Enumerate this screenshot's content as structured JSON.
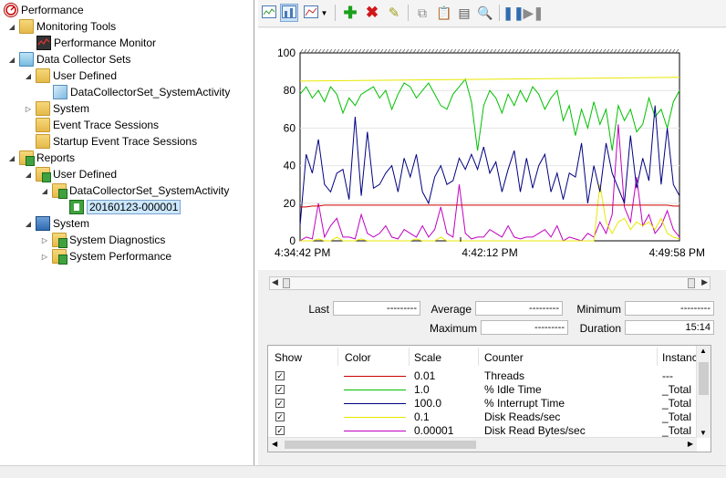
{
  "tree": {
    "root": "Performance",
    "monitoring_tools": "Monitoring Tools",
    "performance_monitor": "Performance Monitor",
    "data_collector_sets": "Data Collector Sets",
    "user_defined": "User Defined",
    "dcs_system_activity": "DataCollectorSet_SystemActivity",
    "system": "System",
    "event_trace_sessions": "Event Trace Sessions",
    "startup_event_trace_sessions": "Startup Event Trace Sessions",
    "reports": "Reports",
    "reports_user_defined": "User Defined",
    "reports_dcs_system_activity": "DataCollectorSet_SystemActivity",
    "report_item": "20160123-000001",
    "reports_system": "System",
    "system_diagnostics": "System Diagnostics",
    "system_performance": "System Performance"
  },
  "toolbar": {
    "buttons": [
      "view-graph-icon",
      "view-histogram-icon",
      "change-graph-type-icon",
      "add-counter-icon",
      "delete-counter-icon",
      "highlight-icon",
      "copy-properties-icon",
      "paste-counter-list-icon",
      "properties-icon",
      "zoom-icon",
      "freeze-display-icon",
      "update-data-icon"
    ]
  },
  "graph": {
    "x_labels": [
      "4:34:42 PM",
      "4:42:12 PM",
      "4:49:58 PM"
    ],
    "y_labels": [
      "100",
      "80",
      "60",
      "40",
      "20",
      "0"
    ]
  },
  "stats": {
    "last_label": "Last",
    "last_value": "---------",
    "average_label": "Average",
    "average_value": "---------",
    "minimum_label": "Minimum",
    "minimum_value": "---------",
    "maximum_label": "Maximum",
    "maximum_value": "---------",
    "duration_label": "Duration",
    "duration_value": "15:14"
  },
  "legend": {
    "headers": {
      "show": "Show",
      "color": "Color",
      "scale": "Scale",
      "counter": "Counter",
      "instance": "Instanc"
    },
    "rows": [
      {
        "scale": "0.01",
        "counter": "Threads",
        "instance": "---",
        "color": "#d00000"
      },
      {
        "scale": "1.0",
        "counter": "% Idle Time",
        "instance": "_Total",
        "color": "#00c000"
      },
      {
        "scale": "100.0",
        "counter": "% Interrupt Time",
        "instance": "_Total",
        "color": "#000080"
      },
      {
        "scale": "0.1",
        "counter": "Disk Reads/sec",
        "instance": "_Total",
        "color": "#e8e800"
      },
      {
        "scale": "0.00001",
        "counter": "Disk Read Bytes/sec",
        "instance": "_Total",
        "color": "#c000c0"
      }
    ]
  },
  "chart_data": {
    "type": "line",
    "ylim": [
      0,
      100
    ],
    "x_ticks": [
      "4:34:42 PM",
      "4:42:12 PM",
      "4:49:58 PM"
    ],
    "grid": true,
    "series": [
      {
        "name": "Threads",
        "color": "#d00000",
        "values": [
          18,
          18,
          18.5,
          18.5,
          19,
          19,
          19,
          19,
          19,
          19,
          19,
          19,
          19,
          19,
          19,
          19,
          19,
          19,
          19,
          19,
          19,
          19,
          19,
          19,
          19,
          19,
          19,
          19,
          19,
          19,
          19,
          19,
          19,
          19,
          19,
          19,
          19,
          19,
          19,
          19,
          19,
          19,
          19,
          19,
          19,
          19,
          19,
          19,
          19,
          19,
          19,
          19,
          19,
          19,
          19,
          19,
          19,
          19,
          19,
          19,
          19,
          18.5,
          18.5
        ]
      },
      {
        "name": "% Idle Time",
        "color": "#00c000",
        "values": [
          78,
          82,
          76,
          80,
          74,
          82,
          78,
          68,
          76,
          72,
          78,
          80,
          82,
          76,
          80,
          70,
          78,
          84,
          82,
          76,
          80,
          84,
          78,
          72,
          70,
          78,
          82,
          86,
          74,
          48,
          72,
          80,
          76,
          68,
          78,
          72,
          80,
          74,
          82,
          78,
          70,
          76,
          80,
          64,
          72,
          56,
          70,
          60,
          74,
          62,
          70,
          48,
          72,
          64,
          70,
          58,
          62,
          76,
          66,
          70,
          60,
          74,
          80
        ]
      },
      {
        "name": "% Interrupt Time",
        "color": "#000080",
        "values": [
          8,
          46,
          36,
          54,
          30,
          26,
          36,
          38,
          22,
          66,
          24,
          58,
          28,
          30,
          36,
          40,
          26,
          44,
          34,
          46,
          26,
          20,
          34,
          40,
          30,
          32,
          44,
          38,
          46,
          38,
          50,
          36,
          42,
          26,
          38,
          48,
          26,
          44,
          28,
          40,
          46,
          26,
          36,
          22,
          36,
          34,
          52,
          20,
          40,
          26,
          52,
          36,
          28,
          20,
          56,
          28,
          44,
          32,
          72,
          30,
          60,
          30,
          24
        ]
      },
      {
        "name": "Disk Reads/sec",
        "color": "#e8e800",
        "values": [
          0,
          0,
          0,
          1,
          0,
          0,
          2,
          0,
          0,
          0,
          1,
          0,
          0,
          0,
          0,
          0,
          0,
          0,
          0,
          1,
          0,
          0,
          0,
          2,
          0,
          0,
          0,
          0,
          0,
          0,
          0,
          0,
          0,
          0,
          0,
          0,
          0,
          0,
          0,
          0,
          0,
          0,
          0,
          0,
          0,
          0,
          0,
          0,
          0,
          30,
          10,
          4,
          10,
          12,
          6,
          10,
          8,
          10,
          6,
          12,
          4,
          2,
          1
        ]
      },
      {
        "name": "Disk Read Bytes/sec",
        "color": "#c000c0",
        "values": [
          0,
          2,
          1,
          20,
          2,
          8,
          12,
          2,
          2,
          1,
          14,
          4,
          2,
          4,
          8,
          2,
          1,
          6,
          4,
          2,
          8,
          2,
          6,
          18,
          4,
          2,
          30,
          4,
          1,
          2,
          2,
          6,
          4,
          2,
          8,
          2,
          1,
          2,
          2,
          4,
          6,
          2,
          8,
          0,
          2,
          1,
          0,
          4,
          2,
          10,
          4,
          14,
          62,
          18,
          10,
          34,
          8,
          14,
          4,
          8,
          16,
          6,
          2
        ]
      }
    ]
  }
}
